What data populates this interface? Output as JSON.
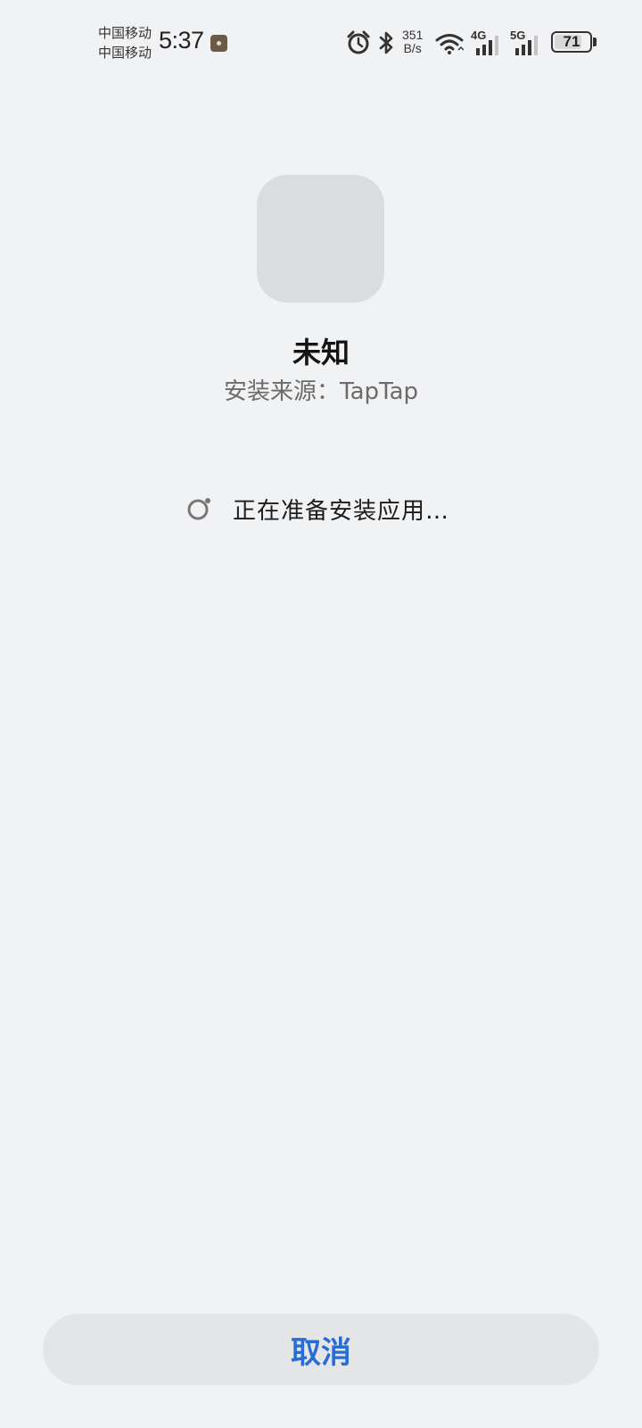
{
  "status_bar": {
    "carrier_1": "中国移动",
    "carrier_2": "中国移动",
    "time": "5:37",
    "net_speed_value": "351",
    "net_speed_unit": "B/s",
    "signal_1_label": "4G",
    "signal_2_label": "5G",
    "battery_level": "71",
    "icons": [
      "app-notification-icon",
      "alarm-icon",
      "bluetooth-icon",
      "wifi-icon",
      "signal-4g-icon",
      "signal-5g-icon",
      "battery-icon"
    ]
  },
  "app": {
    "name": "未知",
    "install_source": "安装来源：TapTap"
  },
  "progress": {
    "message": "正在准备安装应用…"
  },
  "actions": {
    "cancel_label": "取消"
  },
  "colors": {
    "background": "#f1f2f4",
    "accent": "#2a6cd6",
    "button_bg": "#e4e5e7",
    "icon_placeholder": "#dbdcde"
  }
}
